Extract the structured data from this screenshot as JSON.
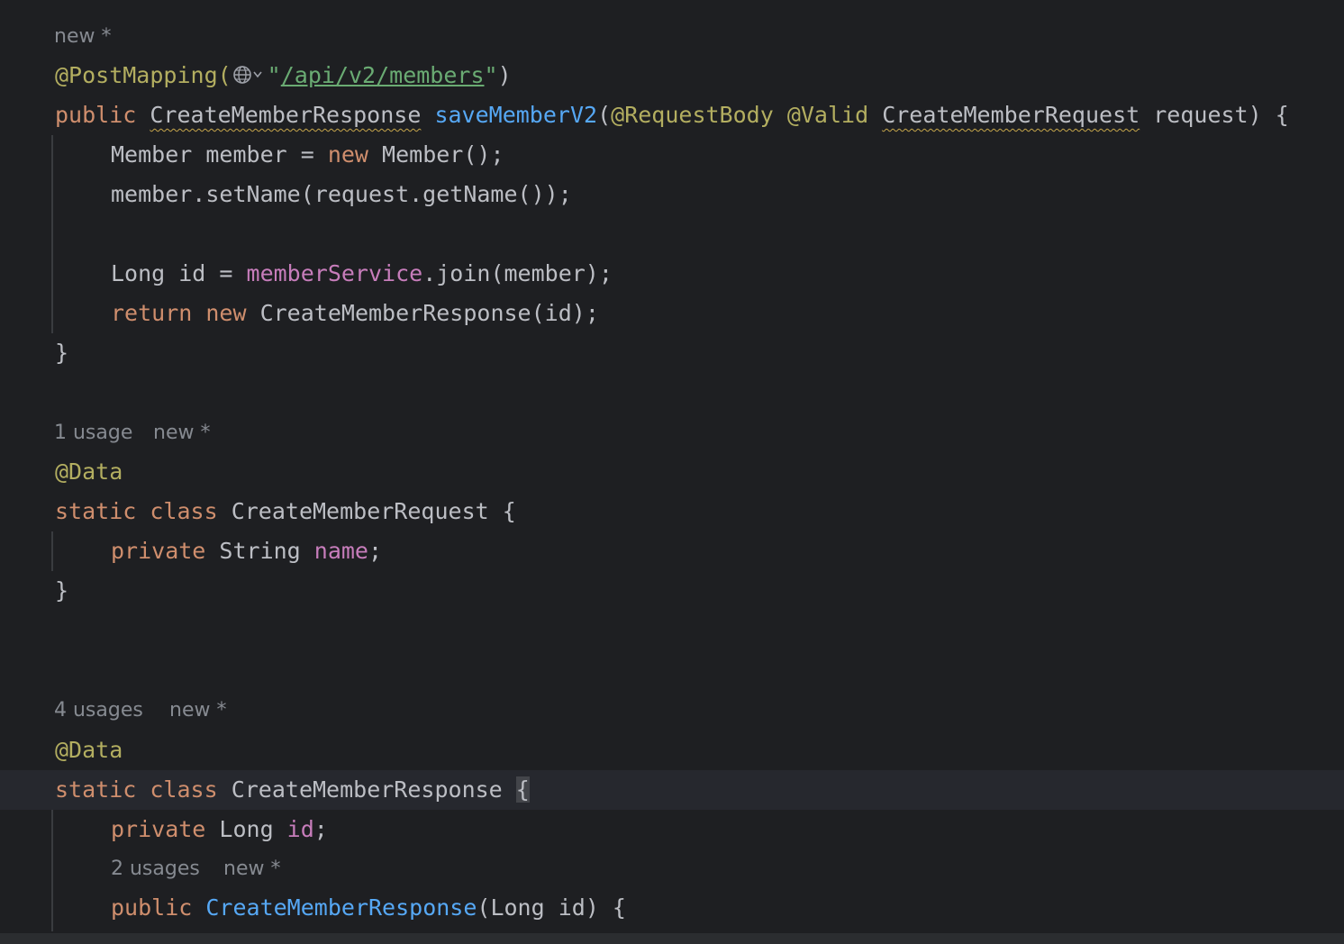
{
  "hints": {
    "h1_new": "new *",
    "h2_usage": "1 usage",
    "h2_new": "new *",
    "h3_usage": "4 usages",
    "h3_new": "new *",
    "h4_usage": "2 usages",
    "h4_new": "new *"
  },
  "code": {
    "l1_ann": "@PostMapping(",
    "l1_q1": "\"",
    "l1_url": "/api/v2/members",
    "l1_q2": "\"",
    "l1_close": ")",
    "l2_public": "public ",
    "l2_type": "CreateMemberResponse",
    "l2_sp": " ",
    "l2_method": "saveMemberV2",
    "l2_paren": "(",
    "l2_ann1": "@RequestBody",
    "l2_sp2": " ",
    "l2_ann2": "@Valid",
    "l2_sp3": " ",
    "l2_ptype": "CreateMemberRequest",
    "l2_rest": " request) {",
    "l3_a": "Member member = ",
    "l3_new": "new",
    "l3_b": " Member();",
    "l4": "member.setName(request.getName());",
    "l6_a": "Long id = ",
    "l6_svc": "memberService",
    "l6_b": ".join(member);",
    "l7_return": "return",
    "l7_sp": " ",
    "l7_new": "new",
    "l7_b": " CreateMemberResponse(id);",
    "l8": "}",
    "l10_ann": "@Data",
    "l11_static": "static",
    "l11_sp": " ",
    "l11_class": "class",
    "l11_b": " CreateMemberRequest {",
    "l12_private": "private",
    "l12_b": " String ",
    "l12_name": "name",
    "l12_c": ";",
    "l13": "}",
    "l16_ann": "@Data",
    "l17_static": "static",
    "l17_sp": " ",
    "l17_class": "class",
    "l17_b": " CreateMemberResponse ",
    "l17_brace": "{",
    "l18_private": "private",
    "l18_b": " Long ",
    "l18_id": "id",
    "l18_c": ";",
    "l20_public": "public",
    "l20_sp": " ",
    "l20_ctor": "CreateMemberResponse",
    "l20_b": "(Long id) {"
  },
  "icons": {
    "globe": "globe-icon",
    "chevron": "chevron-down-icon"
  },
  "colors": {
    "background": "#1e1f22",
    "keyword": "#cf8e6d",
    "annotation": "#b3ae60",
    "string": "#6aab73",
    "method": "#56a8f5",
    "field": "#c77dbb",
    "text": "#bcbec4",
    "hint": "#868a91"
  }
}
